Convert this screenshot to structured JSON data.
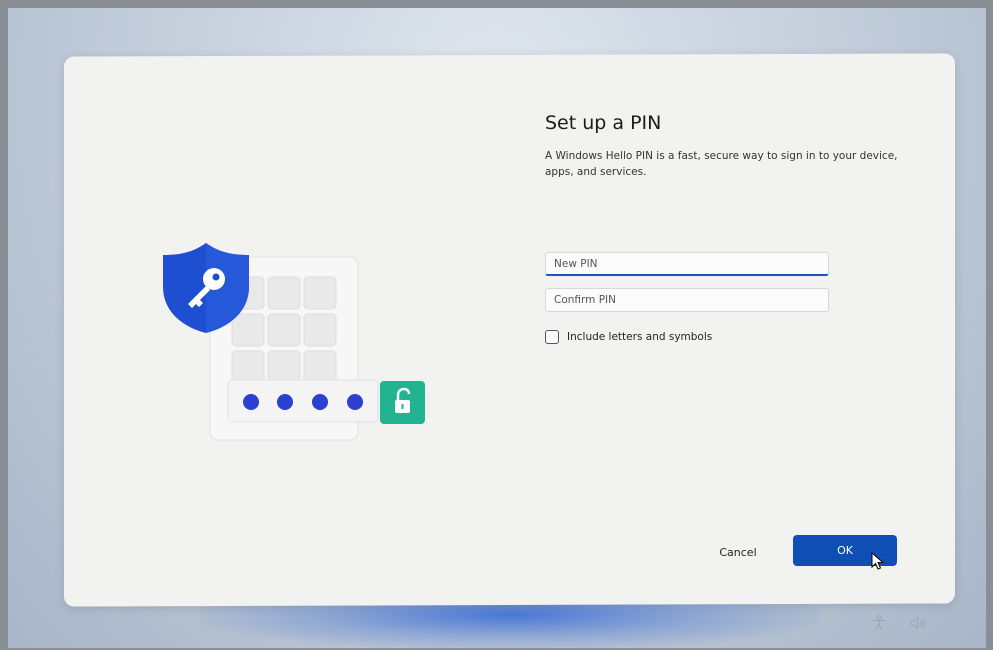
{
  "setup": {
    "title": "Set up a PIN",
    "description": "A Windows Hello PIN is a fast, secure way to sign in to your device, apps, and services.",
    "new_pin_placeholder": "New PIN",
    "confirm_pin_placeholder": "Confirm PIN",
    "include_letters_label": "Include letters and symbols",
    "include_letters_checked": false
  },
  "buttons": {
    "cancel": "Cancel",
    "ok": "OK"
  },
  "colors": {
    "accent": "#0f4fb5",
    "shield": "#1f4fd1",
    "unlock": "#22b391",
    "dots": "#2b3fd0"
  },
  "tray": {
    "icons": [
      "accessibility-icon",
      "volume-icon"
    ]
  }
}
